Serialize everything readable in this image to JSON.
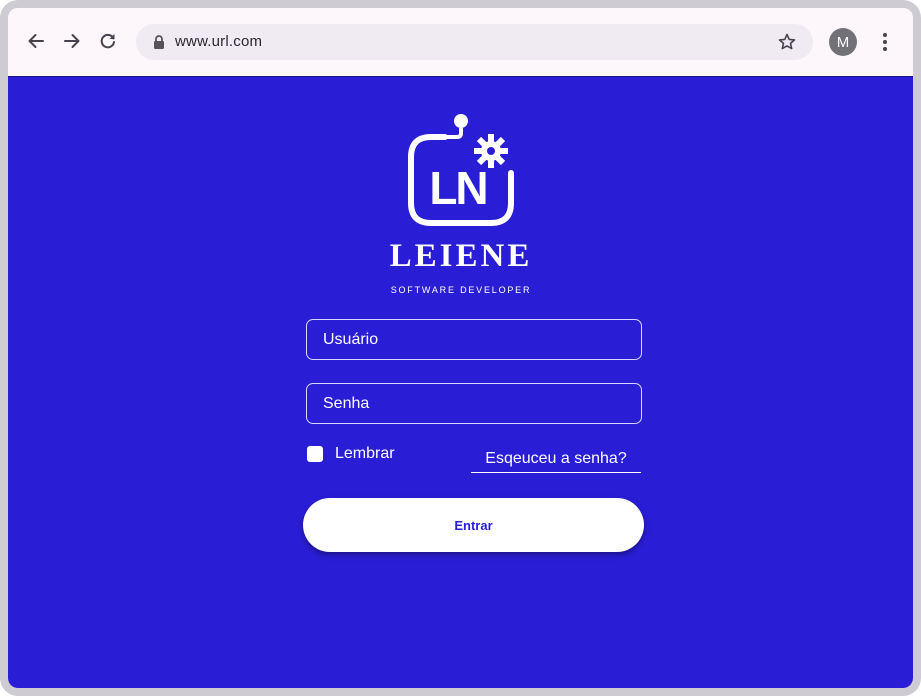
{
  "browser": {
    "url": "www.url.com",
    "avatar_letter": "M",
    "icons": {
      "back": "arrow-left-icon",
      "forward": "arrow-right-icon",
      "reload": "reload-icon",
      "lock": "lock-icon",
      "bookmark": "star-icon",
      "menu": "kebab-menu-icon"
    }
  },
  "brand": {
    "logo_text": "LN",
    "name": "LEIENE",
    "tagline": "SOFTWARE DEVELOPER"
  },
  "login": {
    "username_placeholder": "Usuário",
    "password_placeholder": "Senha",
    "remember_label": "Lembrar",
    "forgot_link": "Esqeuceu a senha?",
    "submit_label": "Entrar"
  },
  "colors": {
    "page_background": "#2a1dd6",
    "button_background": "#ffffff",
    "button_text": "#2a1dd6",
    "browser_chrome": "#fdf7fc"
  }
}
